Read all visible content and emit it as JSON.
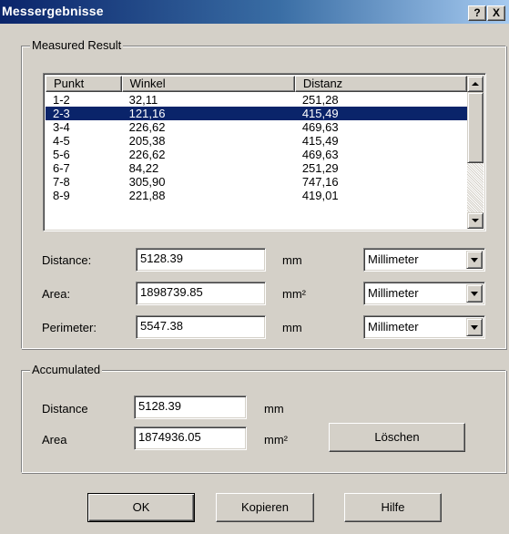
{
  "window": {
    "title": "Messergebnisse",
    "help_button": "?",
    "close_button": "X"
  },
  "measured_group": {
    "label": "Measured Result",
    "columns": [
      "Punkt",
      "Winkel",
      "Distanz"
    ],
    "rows": [
      {
        "punkt": "1-2",
        "winkel": "32,11",
        "distanz": "251,28",
        "selected": false
      },
      {
        "punkt": "2-3",
        "winkel": "121,16",
        "distanz": "415,49",
        "selected": true
      },
      {
        "punkt": "3-4",
        "winkel": "226,62",
        "distanz": "469,63",
        "selected": false
      },
      {
        "punkt": "4-5",
        "winkel": "205,38",
        "distanz": "415,49",
        "selected": false
      },
      {
        "punkt": "5-6",
        "winkel": "226,62",
        "distanz": "469,63",
        "selected": false
      },
      {
        "punkt": "6-7",
        "winkel": "84,22",
        "distanz": "251,29",
        "selected": false
      },
      {
        "punkt": "7-8",
        "winkel": "305,90",
        "distanz": "747,16",
        "selected": false
      },
      {
        "punkt": "8-9",
        "winkel": "221,88",
        "distanz": "419,01",
        "selected": false
      }
    ],
    "distance": {
      "label": "Distance:",
      "value": "5128.39",
      "unit": "mm",
      "unit_select": "Millimeter"
    },
    "area": {
      "label": "Area:",
      "value": "1898739.85",
      "unit": "mm²",
      "unit_select": "Millimeter"
    },
    "perimeter": {
      "label": "Perimeter:",
      "value": "5547.38",
      "unit": "mm",
      "unit_select": "Millimeter"
    }
  },
  "accumulated_group": {
    "label": "Accumulated",
    "distance": {
      "label": "Distance",
      "value": "5128.39",
      "unit": "mm"
    },
    "area": {
      "label": "Area",
      "value": "1874936.05",
      "unit": "mm²"
    },
    "clear_button": "Löschen"
  },
  "buttons": {
    "ok": "OK",
    "copy": "Kopieren",
    "help": "Hilfe"
  }
}
